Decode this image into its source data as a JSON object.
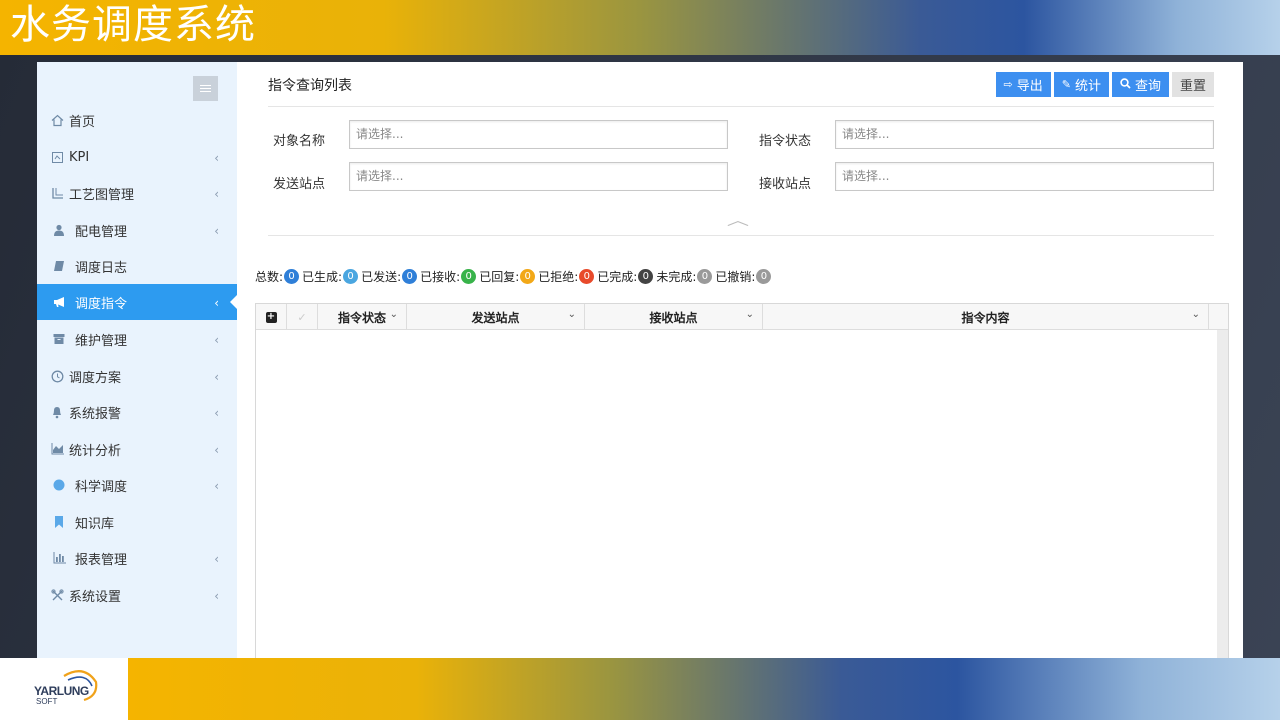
{
  "app": {
    "title": "水务调度系统"
  },
  "logo": {
    "name": "YARLUNG",
    "sub": "SOFT"
  },
  "sidebar": {
    "items": [
      {
        "label": "首页",
        "icon": "home-icon",
        "has_children": false
      },
      {
        "label": "KPI",
        "icon": "kpi-icon",
        "has_children": true
      },
      {
        "label": "工艺图管理",
        "icon": "process-diagram-icon",
        "has_children": true
      },
      {
        "label": "配电管理",
        "icon": "user-icon",
        "has_children": true
      },
      {
        "label": "调度日志",
        "icon": "book-icon",
        "has_children": false
      },
      {
        "label": "调度指令",
        "icon": "bullhorn-icon",
        "has_children": true,
        "active": true
      },
      {
        "label": "维护管理",
        "icon": "archive-icon",
        "has_children": true
      },
      {
        "label": "调度方案",
        "icon": "clock-icon",
        "has_children": true
      },
      {
        "label": "系统报警",
        "icon": "bell-icon",
        "has_children": true
      },
      {
        "label": "统计分析",
        "icon": "area-chart-icon",
        "has_children": true
      },
      {
        "label": "科学调度",
        "icon": "circle-icon",
        "has_children": true
      },
      {
        "label": "知识库",
        "icon": "bookmark-icon",
        "has_children": false
      },
      {
        "label": "报表管理",
        "icon": "bar-chart-icon",
        "has_children": true
      },
      {
        "label": "系统设置",
        "icon": "tools-icon",
        "has_children": true
      }
    ]
  },
  "main": {
    "title": "指令查询列表",
    "toolbar": {
      "export": "导出",
      "stats": "统计",
      "query": "查询",
      "reset": "重置"
    },
    "filters": {
      "object_name": {
        "label": "对象名称",
        "placeholder": "请选择..."
      },
      "command_status": {
        "label": "指令状态",
        "placeholder": "请选择..."
      },
      "send_station": {
        "label": "发送站点",
        "placeholder": "请选择..."
      },
      "receive_station": {
        "label": "接收站点",
        "placeholder": "请选择..."
      }
    },
    "stats": [
      {
        "label": "总数:",
        "count": "0",
        "color": "#2f7fd8"
      },
      {
        "label": "已生成:",
        "count": "0",
        "color": "#4aa6e0"
      },
      {
        "label": "已发送:",
        "count": "0",
        "color": "#2f7fd8"
      },
      {
        "label": "已接收:",
        "count": "0",
        "color": "#38b34a"
      },
      {
        "label": "已回复:",
        "count": "0",
        "color": "#f2a818"
      },
      {
        "label": "已拒绝:",
        "count": "0",
        "color": "#e84a2b"
      },
      {
        "label": "已完成:",
        "count": "0",
        "color": "#444444"
      },
      {
        "label": "未完成:",
        "count": "0",
        "color": "#9a9a9a"
      },
      {
        "label": "已撤销:",
        "count": "0",
        "color": "#9a9a9a"
      }
    ],
    "grid": {
      "columns": [
        "指令状态",
        "发送站点",
        "接收站点",
        "指令内容"
      ]
    }
  }
}
